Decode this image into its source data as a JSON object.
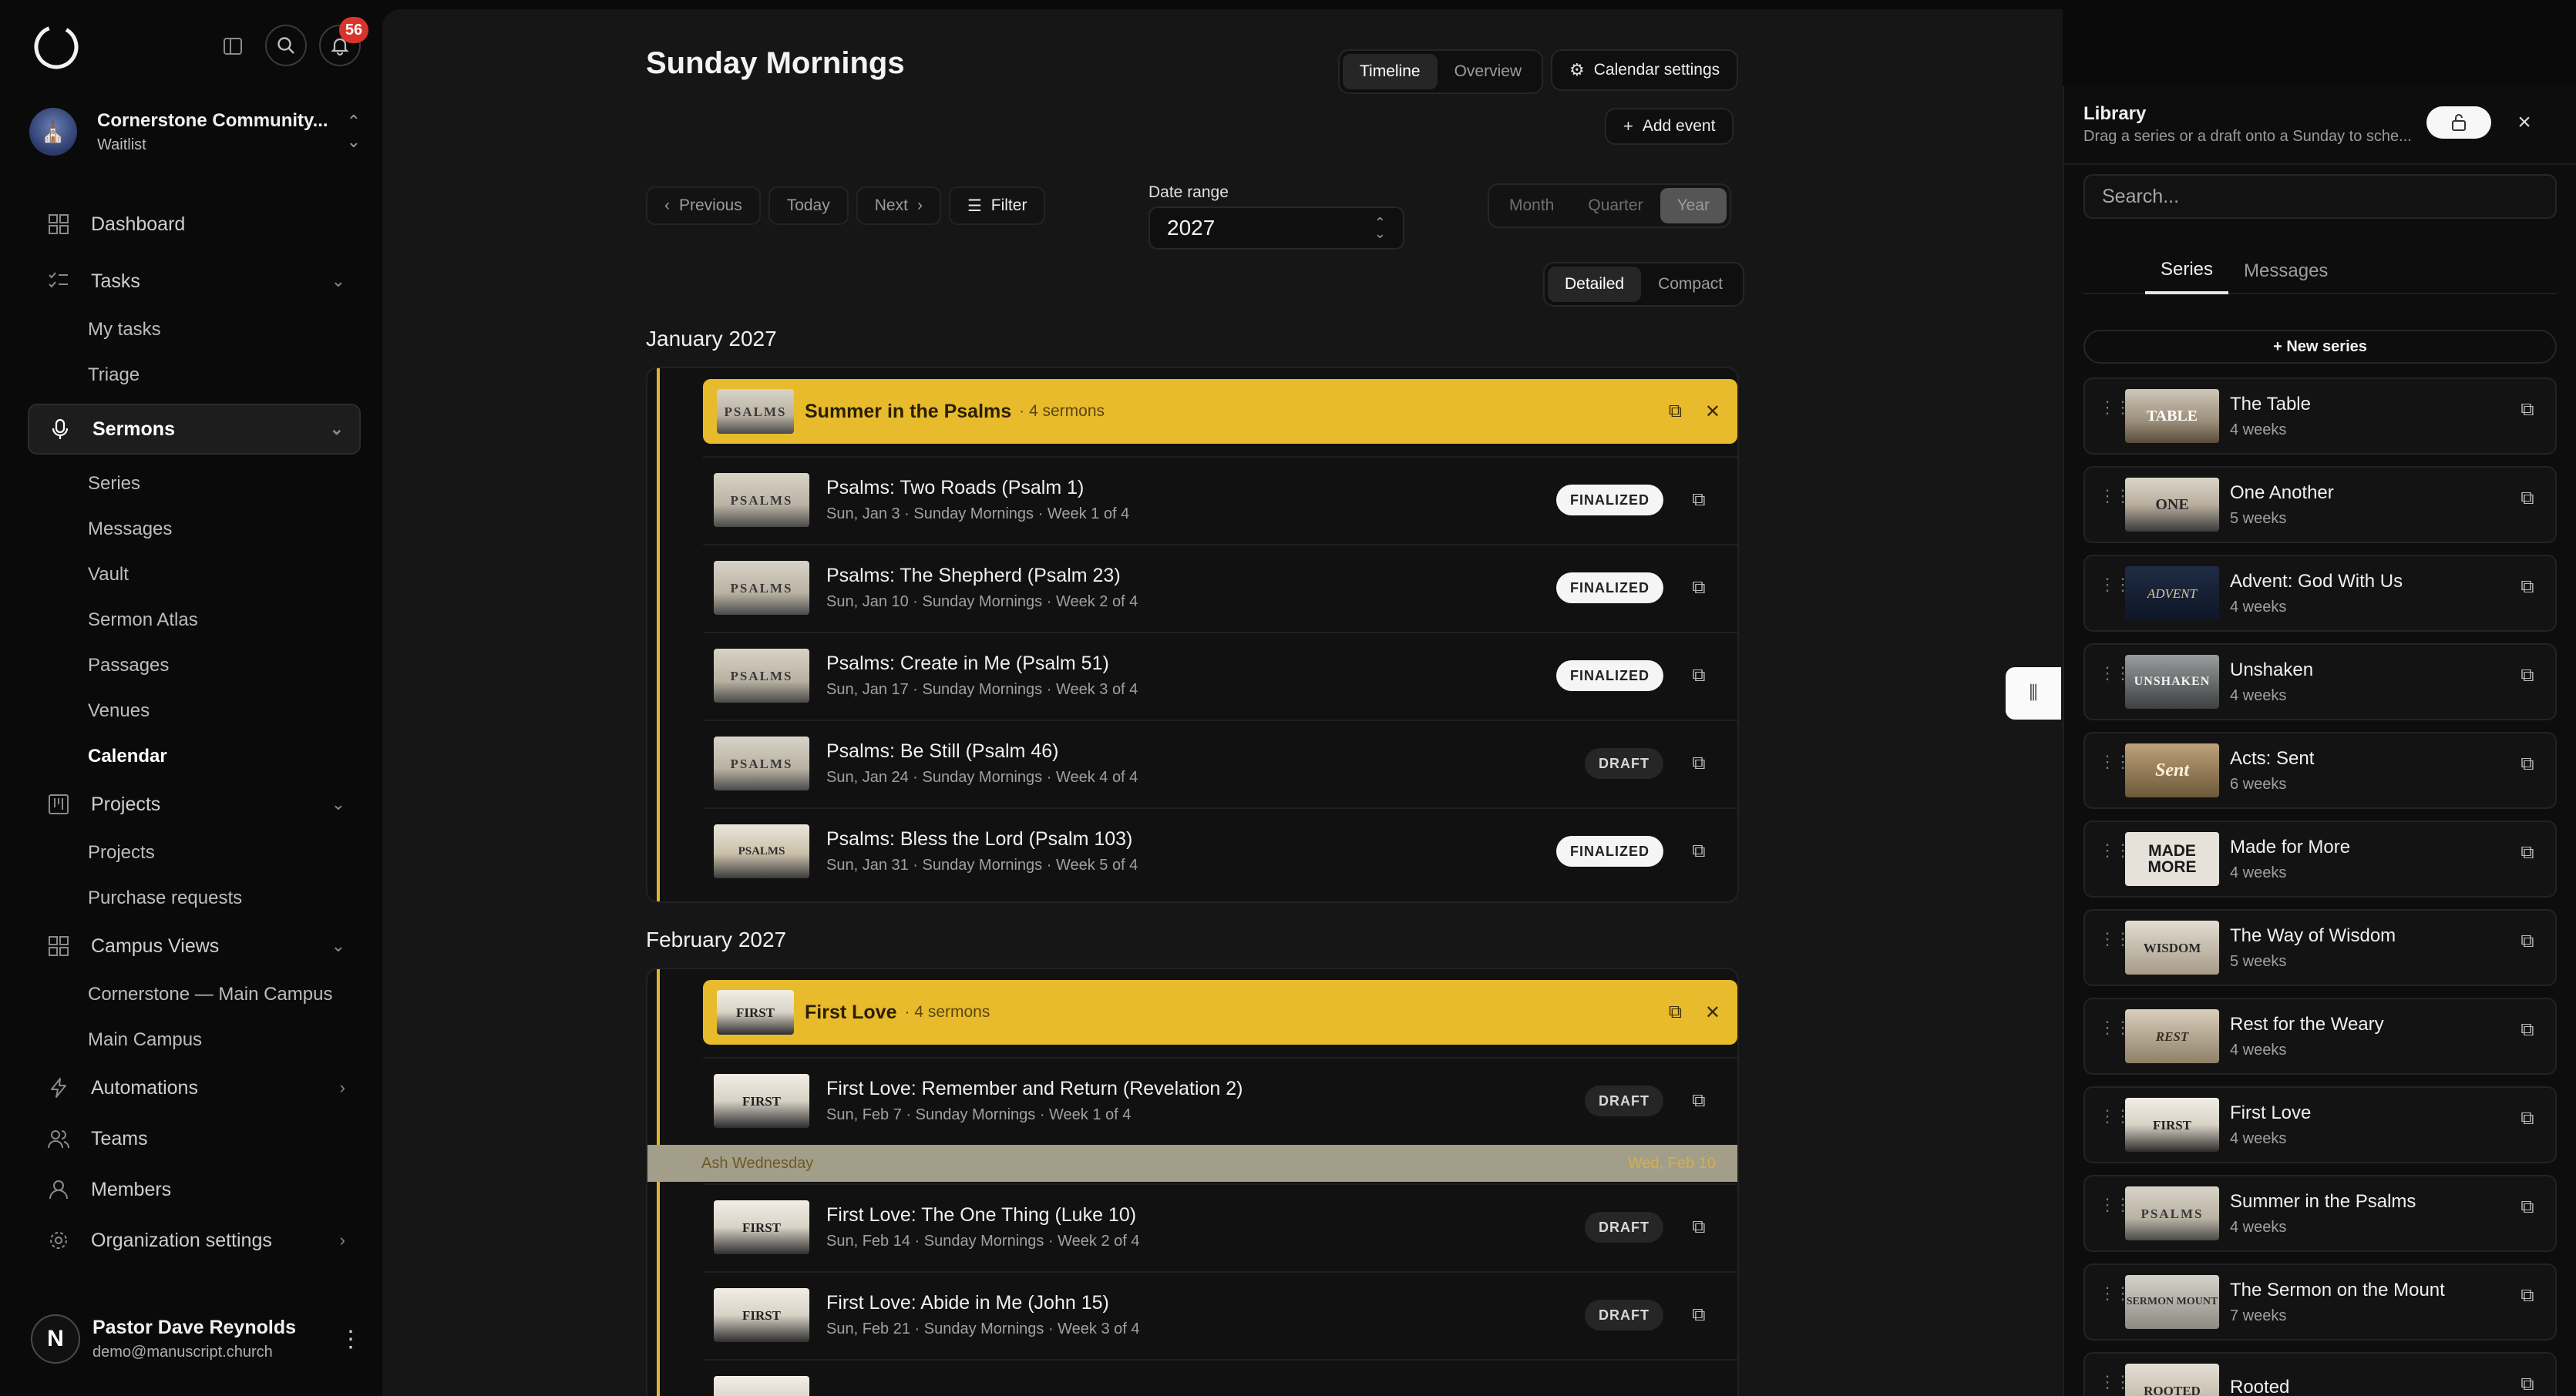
{
  "sidebar": {
    "notifications": "56",
    "org": {
      "name": "Cornerstone Community...",
      "status": "Waitlist"
    },
    "nav": {
      "dashboard": "Dashboard",
      "tasks": "Tasks",
      "my_tasks": "My tasks",
      "triage": "Triage",
      "sermons": "Sermons",
      "series": "Series",
      "messages": "Messages",
      "vault": "Vault",
      "sermon_atlas": "Sermon Atlas",
      "passages": "Passages",
      "venues": "Venues",
      "calendar": "Calendar",
      "projects": "Projects",
      "projects_sub": "Projects",
      "purchase_requests": "Purchase requests",
      "campus_views": "Campus Views",
      "campus_main_full": "Cornerstone — Main Campus",
      "campus_main": "Main Campus",
      "automations": "Automations",
      "teams": "Teams",
      "members": "Members",
      "org_settings": "Organization settings"
    },
    "user": {
      "initial": "N",
      "name": "Pastor Dave Reynolds",
      "email": "demo@manuscript.church"
    }
  },
  "main": {
    "title": "Sunday Mornings",
    "views": {
      "timeline": "Timeline",
      "overview": "Overview"
    },
    "calendar_settings": "Calendar settings",
    "add_event": "Add event",
    "nav": {
      "previous": "Previous",
      "today": "Today",
      "next": "Next",
      "filter": "Filter"
    },
    "date_range": {
      "label": "Date range",
      "value": "2027"
    },
    "scale": {
      "month": "Month",
      "quarter": "Quarter",
      "year": "Year"
    },
    "density": {
      "detailed": "Detailed",
      "compact": "Compact"
    },
    "january": {
      "label": "January 2027",
      "series": {
        "name": "Summer in the Psalms",
        "count": "· 4 sermons",
        "thumb": "PSALMS"
      },
      "rows": [
        {
          "title": "Psalms: Two Roads (Psalm 1)",
          "meta": "Sun, Jan 3 · Sunday Mornings · Week 1 of 4",
          "status": "FINALIZED",
          "thumb": "PSALMS"
        },
        {
          "title": "Psalms: The Shepherd (Psalm 23)",
          "meta": "Sun, Jan 10 · Sunday Mornings · Week 2 of 4",
          "status": "FINALIZED",
          "thumb": "PSALMS"
        },
        {
          "title": "Psalms: Create in Me (Psalm 51)",
          "meta": "Sun, Jan 17 · Sunday Mornings · Week 3 of 4",
          "status": "FINALIZED",
          "thumb": "PSALMS"
        },
        {
          "title": "Psalms: Be Still (Psalm 46)",
          "meta": "Sun, Jan 24 · Sunday Mornings · Week 4 of 4",
          "status": "DRAFT",
          "thumb": "PSALMS"
        },
        {
          "title": "Psalms: Bless the Lord (Psalm 103)",
          "meta": "Sun, Jan 31 · Sunday Mornings · Week 5 of 4",
          "status": "FINALIZED",
          "thumb": "PSALMS"
        }
      ]
    },
    "february": {
      "label": "February 2027",
      "series": {
        "name": "First Love",
        "count": "· 4 sermons",
        "thumb": "FIRST"
      },
      "rows": [
        {
          "title": "First Love: Remember and Return (Revelation 2)",
          "meta": "Sun, Feb 7 · Sunday Mornings · Week 1 of 4",
          "status": "DRAFT",
          "thumb": "FIRST"
        },
        {
          "title": "First Love: The One Thing (Luke 10)",
          "meta": "Sun, Feb 14 · Sunday Mornings · Week 2 of 4",
          "status": "DRAFT",
          "thumb": "FIRST"
        },
        {
          "title": "First Love: Abide in Me (John 15)",
          "meta": "Sun, Feb 21 · Sunday Mornings · Week 3 of 4",
          "status": "DRAFT",
          "thumb": "FIRST"
        }
      ],
      "holiday": {
        "name": "Ash Wednesday",
        "date": "Wed, Feb 10"
      }
    }
  },
  "library": {
    "title": "Library",
    "subtitle": "Drag a series or a draft onto a Sunday to sche...",
    "search_placeholder": "Search...",
    "tabs": {
      "series": "Series",
      "messages": "Messages"
    },
    "new_series": "+ New series",
    "items": [
      {
        "name": "The Table",
        "weeks": "4 weeks",
        "thumb": "TABLE"
      },
      {
        "name": "One Another",
        "weeks": "5 weeks",
        "thumb": "ONE"
      },
      {
        "name": "Advent: God With Us",
        "weeks": "4 weeks",
        "thumb": "ADVENT"
      },
      {
        "name": "Unshaken",
        "weeks": "4 weeks",
        "thumb": "UNSHAKEN"
      },
      {
        "name": "Acts: Sent",
        "weeks": "6 weeks",
        "thumb": "Sent"
      },
      {
        "name": "Made for More",
        "weeks": "4 weeks",
        "thumb": "MADE MORE"
      },
      {
        "name": "The Way of Wisdom",
        "weeks": "5 weeks",
        "thumb": "WISDOM"
      },
      {
        "name": "Rest for the Weary",
        "weeks": "4 weeks",
        "thumb": "REST"
      },
      {
        "name": "First Love",
        "weeks": "4 weeks",
        "thumb": "FIRST"
      },
      {
        "name": "Summer in the Psalms",
        "weeks": "4 weeks",
        "thumb": "PSALMS"
      },
      {
        "name": "The Sermon on the Mount",
        "weeks": "7 weeks",
        "thumb": "SERMON MOUNT"
      },
      {
        "name": "Rooted",
        "weeks": "",
        "thumb": "ROOTED"
      }
    ]
  },
  "colors": {
    "series_banner": "#e8bb2c",
    "accent_rail": "#e2b62a",
    "badge": "#d9342b",
    "background": "#0a0a0a"
  }
}
